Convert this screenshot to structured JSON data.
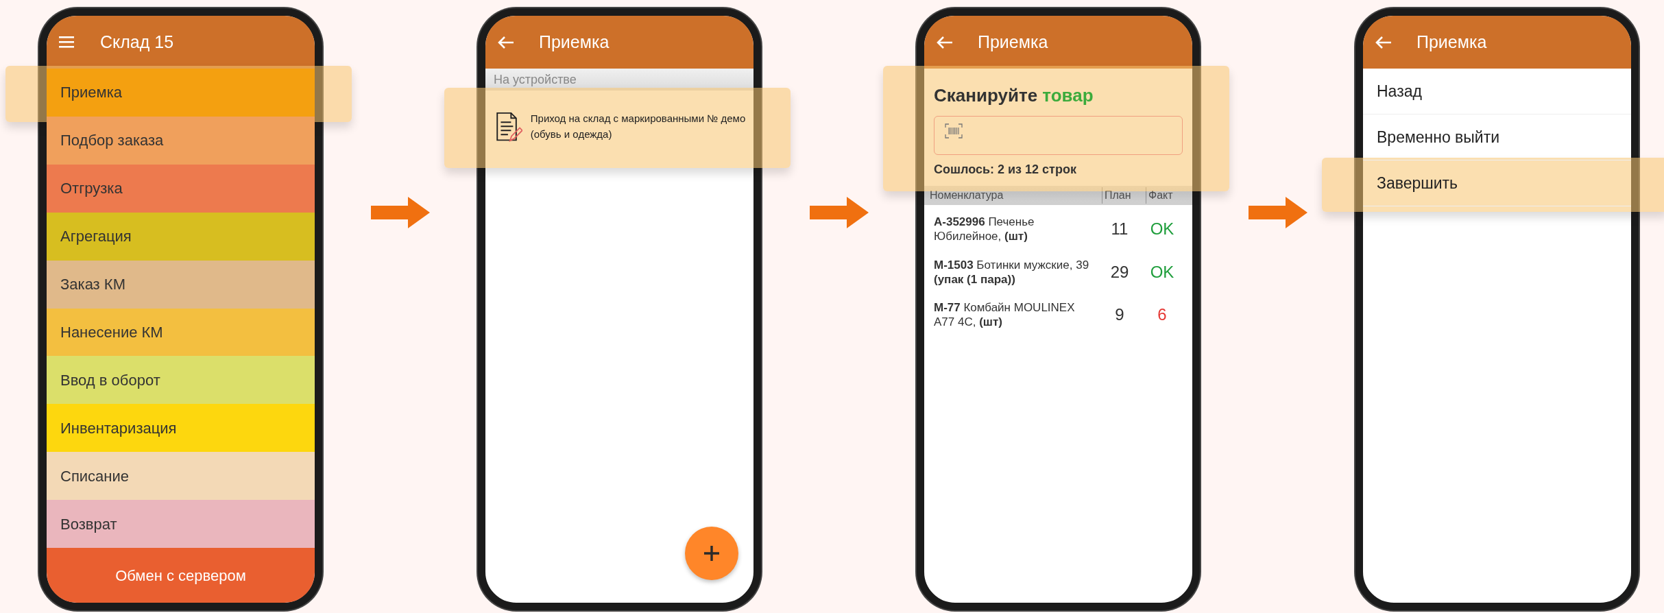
{
  "screens": [
    {
      "kind": "home_menu",
      "header": {
        "title": "Склад 15",
        "kind": "menu"
      },
      "menu_items": [
        {
          "label": "Приемка",
          "color": "#f4a010",
          "highlighted": true
        },
        {
          "label": "Подбор заказа",
          "color": "#f0a05c",
          "highlighted": false
        },
        {
          "label": "Отгрузка",
          "color": "#ed7a4e",
          "highlighted": false
        },
        {
          "label": "Агрегация",
          "color": "#d7be20",
          "highlighted": false
        },
        {
          "label": "Заказ КМ",
          "color": "#e0b98a",
          "highlighted": false
        },
        {
          "label": "Нанесение КМ",
          "color": "#f3bf40",
          "highlighted": false
        },
        {
          "label": "Ввод в оборот",
          "color": "#dbdf6a",
          "highlighted": false
        },
        {
          "label": "Инвентаризация",
          "color": "#fdd70e",
          "highlighted": false
        },
        {
          "label": "Списание",
          "color": "#f3d9b6",
          "highlighted": false
        },
        {
          "label": "Возврат",
          "color": "#eab6bd",
          "highlighted": false
        }
      ],
      "footer_button": "Обмен с сервером"
    },
    {
      "kind": "document_list",
      "header": {
        "title": "Приемка",
        "kind": "back"
      },
      "section": "На устройстве",
      "documents": [
        {
          "title": "Приход на склад с маркированными № демо (обувь и одежда)",
          "highlighted": true
        }
      ]
    },
    {
      "kind": "scan",
      "header": {
        "title": "Приемка",
        "kind": "back"
      },
      "scan_panel": {
        "prompt": "Сканируйте",
        "prompt_accent": "товар",
        "status": "Сошлось: 2 из 12 строк",
        "highlighted": true
      },
      "table": {
        "columns": [
          "Номенклатура",
          "План",
          "Факт"
        ],
        "rows": [
          {
            "item": "**А-352996** Печенье Юбилейное, **(шт)**",
            "plan": "11",
            "fact": "OK",
            "matched": true
          },
          {
            "item": "**М-1503** Ботинки мужские, 39 **(упак (1 пара))**",
            "plan": "29",
            "fact": "OK",
            "matched": true
          },
          {
            "item": "**М-77** Комбайн MOULINEX А77 4С, **(шт)**",
            "plan": "9",
            "fact": "6",
            "matched": false
          }
        ]
      }
    },
    {
      "kind": "action_menu",
      "header": {
        "title": "Приемка",
        "kind": "back"
      },
      "actions": [
        {
          "label": "Назад",
          "highlighted": false
        },
        {
          "label": "Временно выйти",
          "highlighted": false
        },
        {
          "label": "Завершить",
          "highlighted": true
        }
      ]
    }
  ]
}
